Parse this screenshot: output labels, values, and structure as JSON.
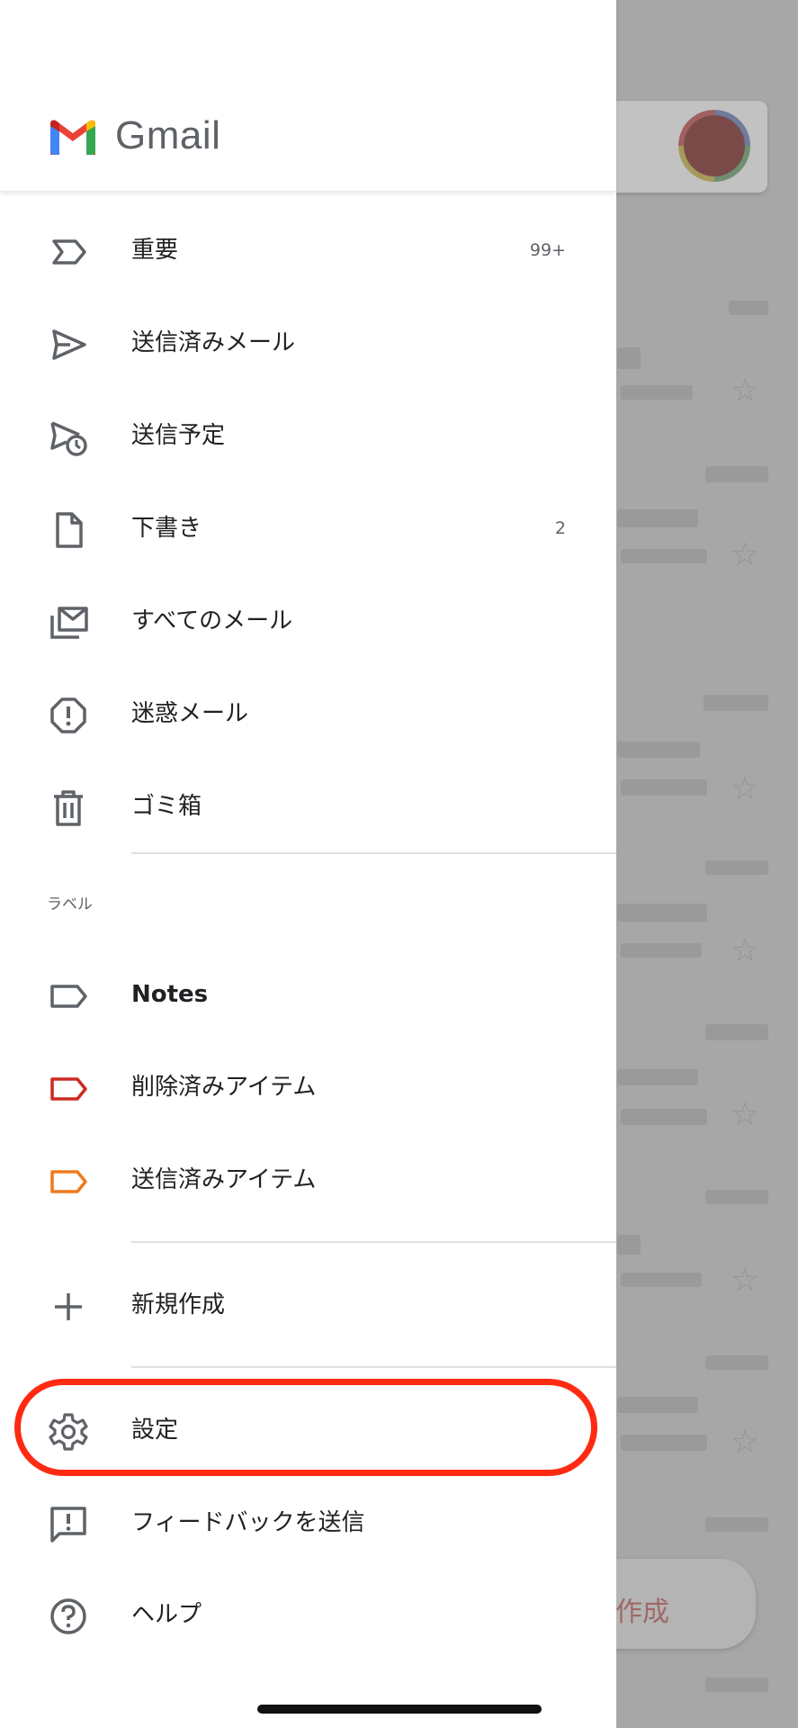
{
  "app": {
    "name": "Gmail"
  },
  "nav": {
    "important": {
      "label": "重要",
      "count": "99+"
    },
    "sent": {
      "label": "送信済みメール"
    },
    "scheduled": {
      "label": "送信予定"
    },
    "drafts": {
      "label": "下書き",
      "count": "2"
    },
    "all_mail": {
      "label": "すべてのメール"
    },
    "spam": {
      "label": "迷惑メール"
    },
    "trash": {
      "label": "ゴミ箱"
    }
  },
  "labels_section": {
    "title": "ラベル",
    "items": [
      {
        "label": "Notes",
        "color": "#5f6368"
      },
      {
        "label": "削除済みアイテム",
        "color": "#cc2a22"
      },
      {
        "label": "送信済みアイテム",
        "color": "#f07a1c"
      }
    ]
  },
  "footer_nav": {
    "create": {
      "label": "新規作成"
    },
    "settings": {
      "label": "設定"
    },
    "feedback": {
      "label": "フィードバックを送信"
    },
    "help": {
      "label": "ヘルプ"
    }
  },
  "annotation": {
    "highlight_color": "#ff2a12"
  },
  "background_app": {
    "fab_label": "作成"
  }
}
